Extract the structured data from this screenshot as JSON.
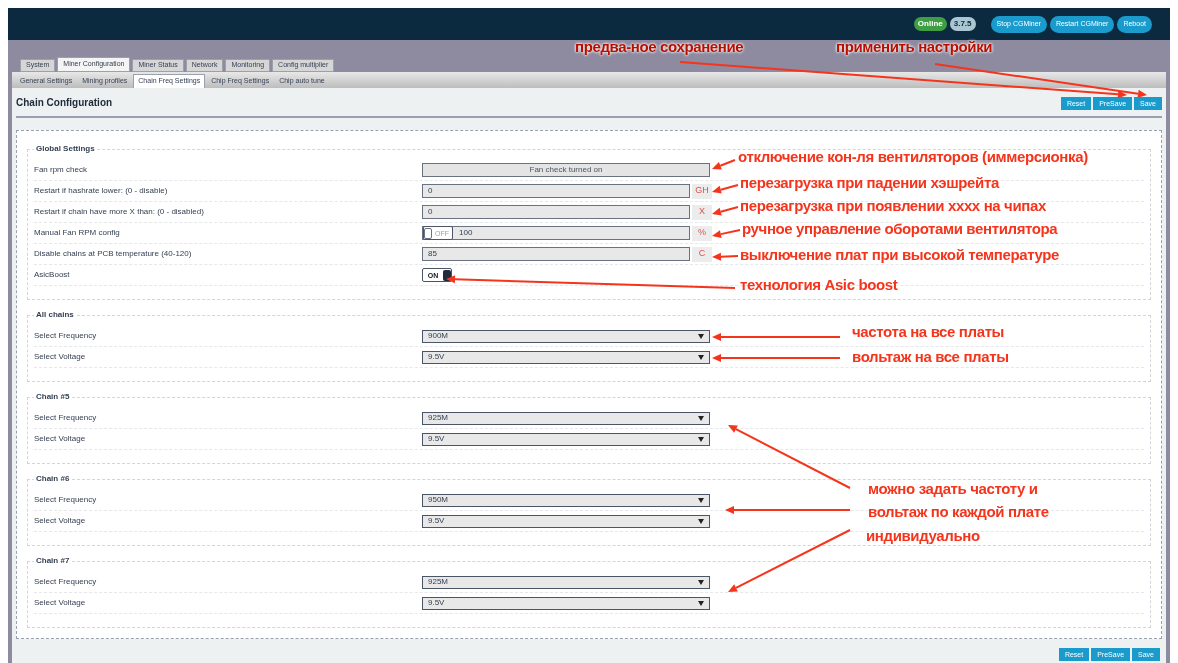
{
  "header": {
    "status_badge": "Online",
    "version_badge": "3.7.5",
    "buttons": [
      "Stop CGMiner",
      "Restart CGMiner",
      "Reboot"
    ]
  },
  "tabs": [
    {
      "label": "System",
      "selected": false
    },
    {
      "label": "Miner Configuration",
      "selected": true
    },
    {
      "label": "Miner Status",
      "selected": false
    },
    {
      "label": "Network",
      "selected": false
    },
    {
      "label": "Monitoring",
      "selected": false
    },
    {
      "label": "Config multiplier",
      "selected": false
    }
  ],
  "subtabs": [
    {
      "label": "General Settings",
      "selected": false
    },
    {
      "label": "Mining profiles",
      "selected": false
    },
    {
      "label": "Chain Freq Settings",
      "selected": true
    },
    {
      "label": "Chip Freq Settings",
      "selected": false
    },
    {
      "label": "Chip auto tune",
      "selected": false
    }
  ],
  "page_title": "Chain Configuration",
  "action_buttons": [
    "Reset",
    "PreSave",
    "Save"
  ],
  "sections": [
    {
      "legend": "Global Settings",
      "rows": [
        {
          "kind": "button",
          "label": "Fan rpm check",
          "value": "Fan check turned on"
        },
        {
          "kind": "text",
          "label": "Restart if hashrate lower: (0 - disable)",
          "value": "0",
          "unit": "GH"
        },
        {
          "kind": "text",
          "label": "Restart if chain have more X than: (0 - disabled)",
          "value": "0",
          "unit": "X"
        },
        {
          "kind": "toggle-text",
          "label": "Manual Fan RPM config",
          "toggle_label": "OFF",
          "on": false,
          "value": "100",
          "unit": "%"
        },
        {
          "kind": "text",
          "label": "Disable chains at PCB temperature (40-120)",
          "value": "85",
          "unit": "C"
        },
        {
          "kind": "toggle",
          "label": "AsicBoost",
          "toggle_label": "ON",
          "on": true
        }
      ]
    },
    {
      "legend": "All chains",
      "rows": [
        {
          "kind": "select",
          "label": "Select Frequency",
          "value": "900M"
        },
        {
          "kind": "select",
          "label": "Select Voltage",
          "value": "9.5V"
        }
      ]
    },
    {
      "legend": "Chain #5",
      "rows": [
        {
          "kind": "select",
          "label": "Select Frequency",
          "value": "925M"
        },
        {
          "kind": "select",
          "label": "Select Voltage",
          "value": "9.5V"
        }
      ]
    },
    {
      "legend": "Chain #6",
      "rows": [
        {
          "kind": "select",
          "label": "Select Frequency",
          "value": "950M"
        },
        {
          "kind": "select",
          "label": "Select Voltage",
          "value": "9.5V"
        }
      ]
    },
    {
      "legend": "Chain #7",
      "rows": [
        {
          "kind": "select",
          "label": "Select Frequency",
          "value": "925M"
        },
        {
          "kind": "select",
          "label": "Select Voltage",
          "value": "9.5V"
        }
      ]
    }
  ],
  "bottom_buttons": [
    "Reset",
    "PreSave",
    "Save"
  ],
  "annotations": [
    "предва-ное сохранение",
    "применить настройки",
    "отключение кон-ля вентиляторов (иммерсионка)",
    "перезагрузка при падении хэшрейта",
    "перезагрузка при появлении хххх на чипах",
    "ручное управление оборотами вентилятора",
    "выключение плат при высокой температуре",
    "технология Asic boost",
    "частота на все платы",
    "вольтаж на все платы",
    "можно задать частоту и",
    "вольтаж по каждой плате",
    "индивидуально"
  ]
}
